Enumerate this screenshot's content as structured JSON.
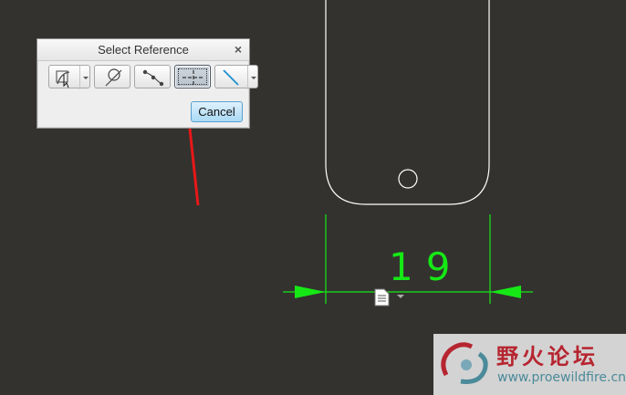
{
  "dialog": {
    "title": "Select Reference",
    "close_symbol": "×",
    "toolbar": [
      {
        "icon": "select-curve-icon",
        "has_dropdown": true,
        "active": false
      },
      {
        "icon": "circle-tangent-icon",
        "has_dropdown": false,
        "active": false
      },
      {
        "icon": "node-chain-icon",
        "has_dropdown": false,
        "active": false
      },
      {
        "icon": "crosshair-centerline-icon",
        "has_dropdown": false,
        "active": true
      },
      {
        "icon": "diagonal-line-icon",
        "has_dropdown": true,
        "active": false
      }
    ],
    "cancel_label": "Cancel"
  },
  "sketch": {
    "dimension_value": "19",
    "colors": {
      "background": "#33322f",
      "geometry": "#ffffff",
      "dimension": "#16e816",
      "pointer_arrow": "#e81818"
    }
  },
  "watermark": {
    "title": "野火论坛",
    "url": "www.proewildfire.cn"
  }
}
